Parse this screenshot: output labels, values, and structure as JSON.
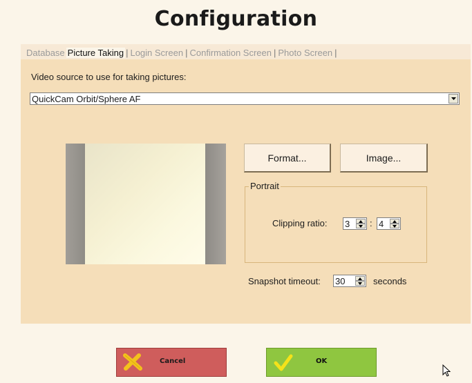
{
  "window": {
    "title": "Configuration"
  },
  "tabs": [
    {
      "label": "Database",
      "active": false
    },
    {
      "label": "Picture Taking",
      "active": true
    },
    {
      "label": "Login Screen",
      "active": false
    },
    {
      "label": "Confirmation Screen",
      "active": false
    },
    {
      "label": "Photo Screen",
      "active": false
    }
  ],
  "picture_taking": {
    "video_source_label": "Video source to use for taking pictures:",
    "video_source_value": "QuickCam Orbit/Sphere AF",
    "format_button": "Format...",
    "image_button": "Image...",
    "portrait_group": {
      "title": "Portrait",
      "clipping_label": "Clipping ratio:",
      "ratio_a": "3",
      "ratio_separator": ":",
      "ratio_b": "4"
    },
    "snapshot_label": "Snapshot timeout:",
    "snapshot_value": "30",
    "snapshot_unit": "seconds"
  },
  "footer": {
    "cancel_label": "Cancel",
    "ok_label": "OK"
  },
  "icons": {
    "combo_arrow": "chevron-down-icon",
    "cancel": "x-icon",
    "ok": "check-icon",
    "cursor": "mouse-pointer-icon"
  },
  "colors": {
    "panel": "#f5deb9",
    "cancel": "#cf5d5c",
    "ok": "#8fc640",
    "group_border": "#d7b57b"
  }
}
